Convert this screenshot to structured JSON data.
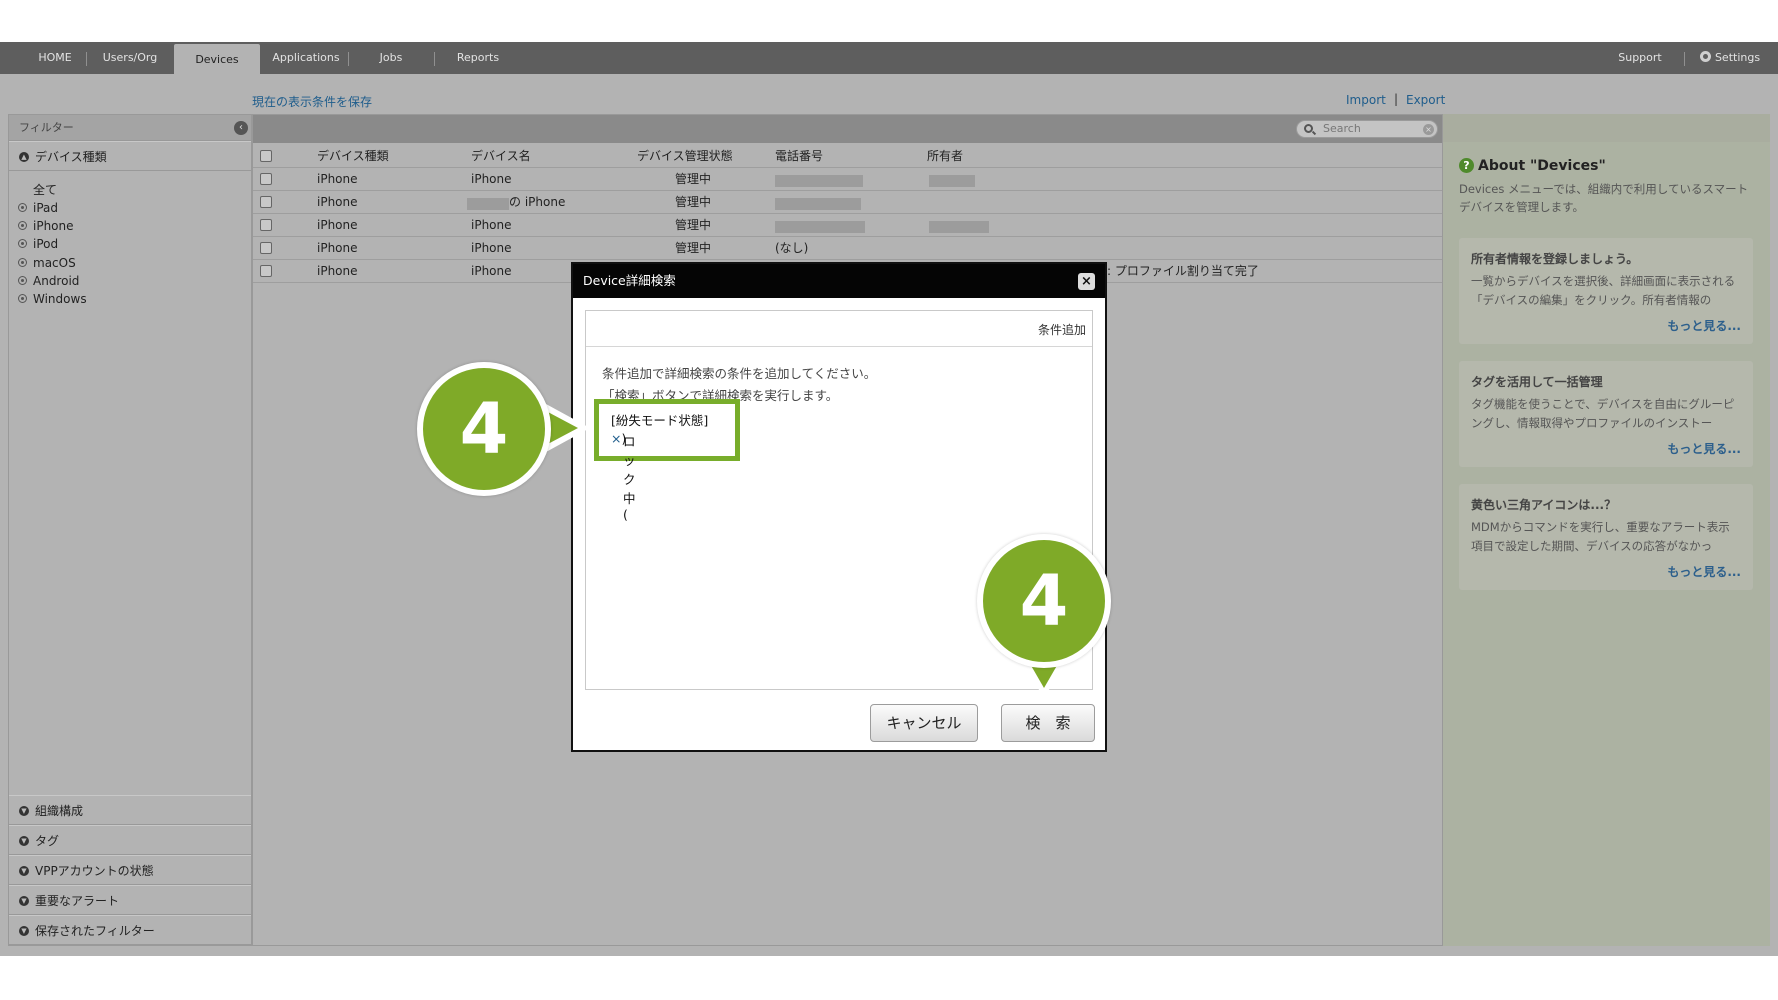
{
  "nav": {
    "tabs": [
      "HOME",
      "Users/Org",
      "Devices",
      "Applications",
      "Jobs",
      "Reports"
    ],
    "active_tab": "Devices",
    "support": "Support",
    "settings": "Settings"
  },
  "links": {
    "save_view": "現在の表示条件を保存",
    "import": "Import",
    "export": "Export",
    "separator": "|"
  },
  "filter": {
    "title": "フィルター",
    "device_type_section": "デバイス種類",
    "device_types": [
      "全て",
      "iPad",
      "iPhone",
      "iPod",
      "macOS",
      "Android",
      "Windows"
    ],
    "sections": [
      "組織構成",
      "タグ",
      "VPPアカウントの状態",
      "重要なアラート",
      "保存されたフィルター"
    ]
  },
  "search": {
    "placeholder": "Search"
  },
  "table": {
    "columns": [
      "デバイス種類",
      "デバイス名",
      "デバイス管理状態",
      "電話番号",
      "所有者"
    ],
    "rows": [
      {
        "type": "iPhone",
        "name": "iPhone",
        "state": "管理中",
        "phone": "",
        "owner": ""
      },
      {
        "type": "iPhone",
        "name": "の iPhone",
        "state": "管理中",
        "phone": "",
        "owner": ""
      },
      {
        "type": "iPhone",
        "name": "iPhone",
        "state": "管理中",
        "phone": "",
        "owner": ""
      },
      {
        "type": "iPhone",
        "name": "iPhone",
        "state": "管理中",
        "phone": "(なし)",
        "owner": ""
      },
      {
        "type": "iPhone",
        "name": "iPhone",
        "state": "",
        "phone": "",
        "owner": "",
        "extra": ": プロファイル割り当て完了"
      }
    ]
  },
  "about": {
    "title": "About \"Devices\"",
    "description": "Devices メニューでは、組織内で利用しているスマートデバイスを管理します。",
    "tips": [
      {
        "title": "所有者情報を登録しましょう。",
        "body": "一覧からデバイスを選択後、詳細画面に表示される「デバイスの編集」をクリック。所有者情報の",
        "more": "もっと見る..."
      },
      {
        "title": "タグを活用して一括管理",
        "body": "タグ機能を使うことで、デバイスを自由にグルーピングし、情報取得やプロファイルのインストー",
        "more": "もっと見る..."
      },
      {
        "title": "黄色い三角アイコンは...？",
        "body": "MDMからコマンドを実行し、重要なアラート表示項目で設定した期間、デバイスの応答がなかっ",
        "more": "もっと見る..."
      }
    ]
  },
  "modal": {
    "title": "Device詳細検索",
    "add_condition": "条件追加",
    "instruction_1": "条件追加で詳細検索の条件を追加してください。",
    "instruction_2": "「検索」ボタンで詳細検索を実行します。",
    "condition_name": "[紛失モード状態]",
    "condition_value": "ロック中 (",
    "condition_remove": "×",
    "condition_close_paren": ")",
    "cancel": "キャンセル",
    "search": "検　索"
  },
  "callouts": [
    "4",
    "4"
  ],
  "colors": {
    "accent_green": "#7faa28",
    "nav_bg": "#5e5e5e",
    "link": "#1f5d8c"
  }
}
